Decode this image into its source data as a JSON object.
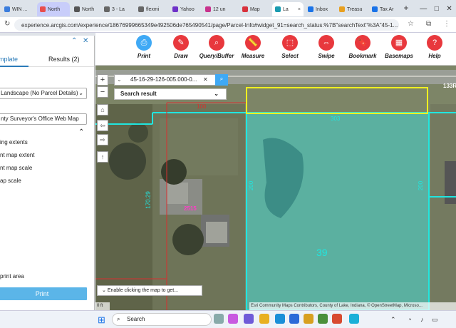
{
  "browser": {
    "tabs": [
      {
        "label": "WIN ...",
        "color": "#3b7ddd"
      },
      {
        "label": "North",
        "color": "#e84d4d"
      },
      {
        "label": "North",
        "color": "#555555"
      },
      {
        "label": "3 - La",
        "color": "#666666"
      },
      {
        "label": "flexmi",
        "color": "#666666"
      },
      {
        "label": "Yahoo",
        "color": "#6e32c8"
      },
      {
        "label": "12 un",
        "color": "#c8328c"
      },
      {
        "label": "Map",
        "color": "#d8323c"
      },
      {
        "label": "La",
        "color": "#1a9bb0"
      },
      {
        "label": "Inbox",
        "color": "#1a73e8"
      },
      {
        "label": "Treasu",
        "color": "#e8a020"
      },
      {
        "label": "Tax Ar",
        "color": "#1a73e8"
      }
    ],
    "close_tab": "×",
    "new_tab": "+",
    "window_controls": {
      "minimize": "—",
      "maximize": "□",
      "close": "✕"
    },
    "url": "experience.arcgis.com/experience/18676999665349e492506de765490541/page/Parcel-Info#widget_91=search_status:%7B\"searchText\"%3A\"45-1..."
  },
  "left_panel": {
    "tabs": [
      "mplate",
      "Results (2)"
    ],
    "layout_value": "Landscape (No Parcel Details)",
    "title_value": "nty Surveyor's Office Web Map",
    "options": [
      "ing extents",
      "nt map extent",
      "nt map scale",
      "ap scale"
    ],
    "print_area_label": "print area",
    "print_button": "Print"
  },
  "toolbar": {
    "tools": [
      {
        "label": "Print",
        "icon": "printer-icon",
        "glyph": "⎙"
      },
      {
        "label": "Draw",
        "icon": "draw-icon",
        "glyph": "✎"
      },
      {
        "label": "Query/Buffer",
        "icon": "query-icon",
        "glyph": "⌕"
      },
      {
        "label": "Measure",
        "icon": "measure-icon",
        "glyph": "📏"
      },
      {
        "label": "Select",
        "icon": "select-icon",
        "glyph": "⬚"
      },
      {
        "label": "Swipe",
        "icon": "swipe-icon",
        "glyph": "⇔"
      },
      {
        "label": "Bookmark",
        "icon": "bookmark-icon",
        "glyph": "🔖"
      },
      {
        "label": "Basemaps",
        "icon": "basemaps-icon",
        "glyph": "▦"
      },
      {
        "label": "Help",
        "icon": "help-icon",
        "glyph": "?"
      }
    ]
  },
  "map": {
    "zoom_in": "+",
    "zoom_out": "−",
    "search_text": "45-16-29-126-005.000-0...",
    "search_result_label": "Search result",
    "parcel_number_label": "39",
    "address_label": "2515",
    "dimension_labels": [
      "200",
      "200",
      "200",
      "170.29",
      "100",
      "303",
      "40",
      "13R",
      "133R"
    ],
    "hint_text": "Enable clicking the map to get...",
    "scale_text": "0 ft",
    "attribution": "Esri Community Maps Contributors, County of Lake, Indiana, © OpenStreetMap, Microso..."
  },
  "taskbar": {
    "search_placeholder": "Search"
  },
  "colors": {
    "accent": "#e8383d",
    "parcel_fill": "#3fd3cf",
    "parcel_outline": "#20e6e0",
    "selection_yellow": "#f0f020",
    "tab_blue": "#2b7bb9",
    "print_blue": "#5bb5e8"
  }
}
